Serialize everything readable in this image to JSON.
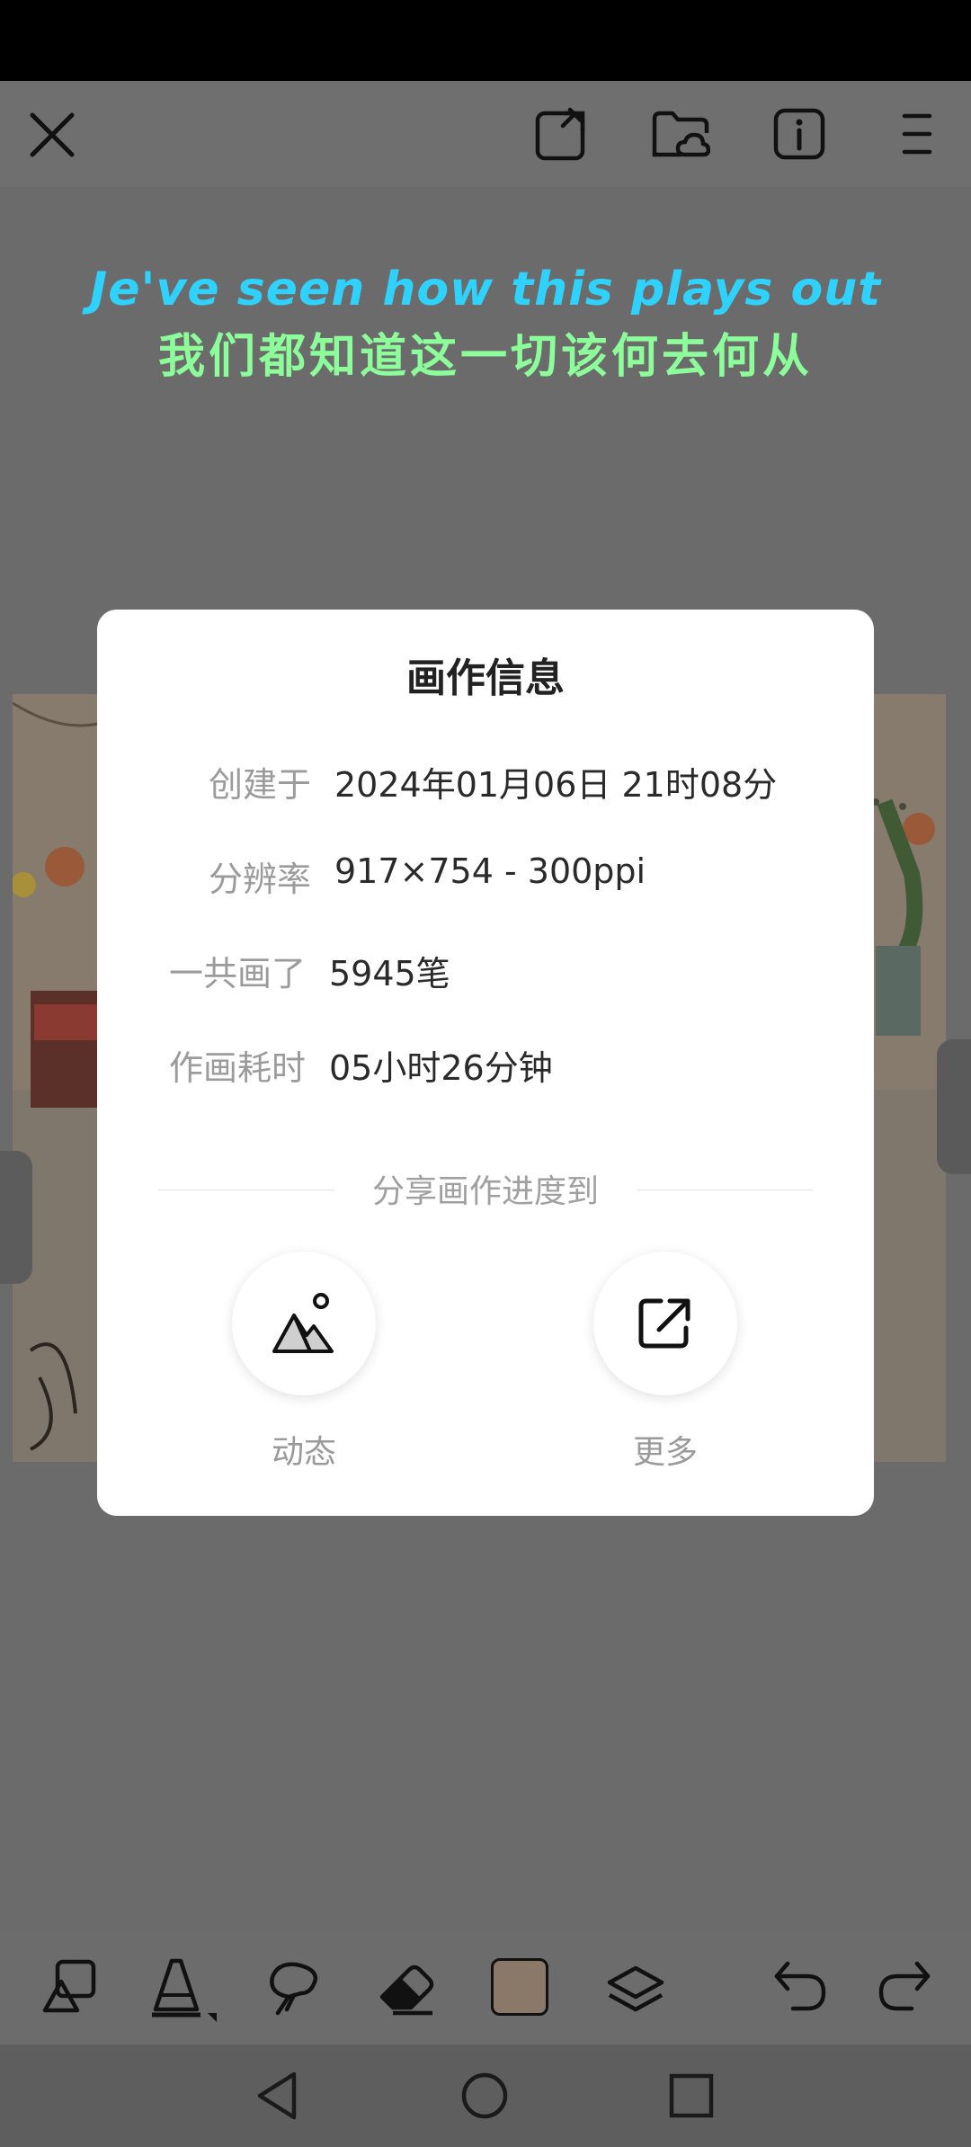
{
  "top_bar": {
    "close_icon": "close-icon",
    "icons": [
      "edit-export-icon",
      "cloud-folder-icon",
      "info-icon",
      "menu-icon"
    ]
  },
  "lyrics": {
    "line1": "Je've seen how this plays out",
    "line2": "我们都知道这一切该何去何从"
  },
  "dialog": {
    "title": "画作信息",
    "rows": [
      {
        "label": "创建于",
        "value": "2024年01月06日 21时08分"
      },
      {
        "label": "分辨率",
        "value": "917×754 - 300ppi"
      },
      {
        "label": "一共画了",
        "value": "5945笔"
      },
      {
        "label": "作画耗时",
        "value": "05小时26分钟"
      }
    ],
    "share_heading": "分享画作进度到",
    "share_options": [
      {
        "label": "动态",
        "icon": "mountain-image-icon"
      },
      {
        "label": "更多",
        "icon": "external-share-icon"
      }
    ]
  },
  "toolbar": {
    "tools": [
      "shapes-icon",
      "brush-cone-icon",
      "smudge-icon",
      "eraser-icon",
      "color-swatch",
      "layers-icon",
      "undo-icon",
      "redo-icon"
    ],
    "swatch_color": "#8a7868"
  },
  "nav": {
    "buttons": [
      "back-icon",
      "home-icon",
      "recents-icon"
    ]
  }
}
